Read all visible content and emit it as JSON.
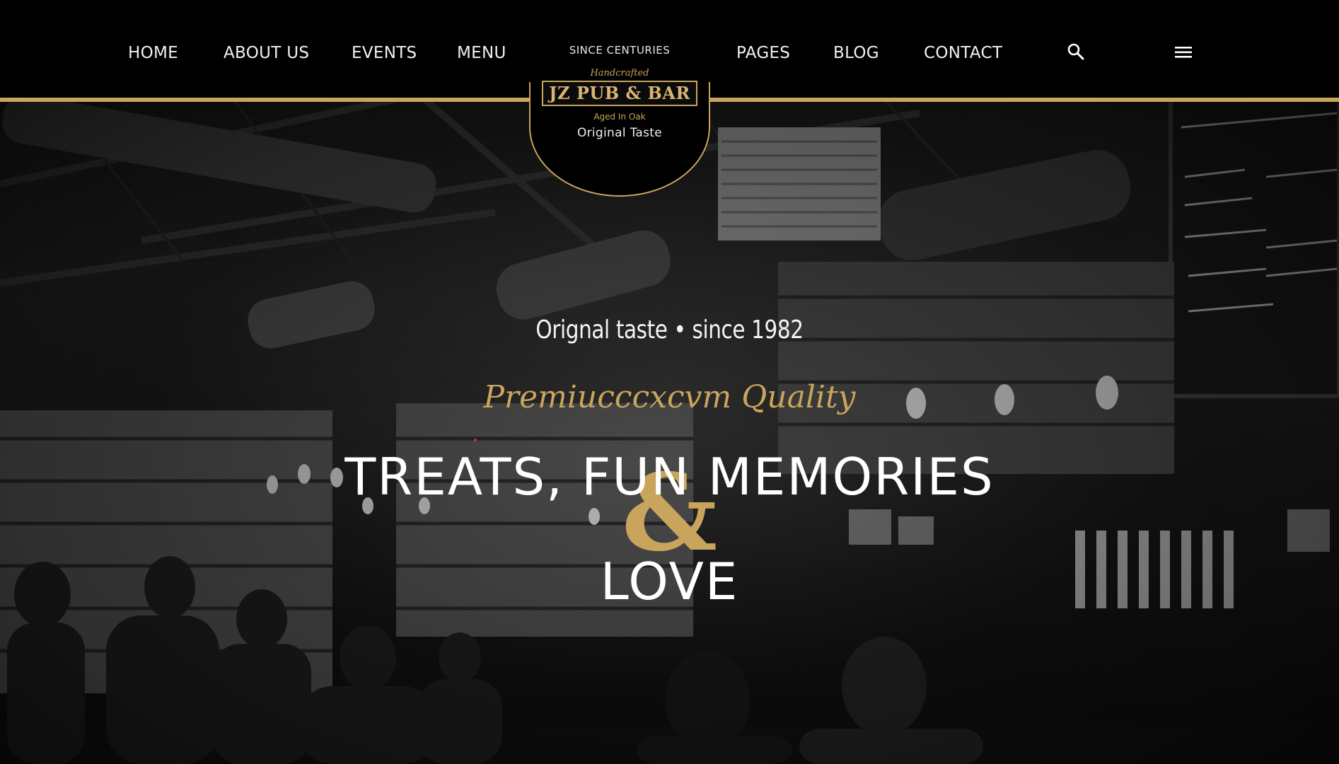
{
  "nav": {
    "left": [
      {
        "label": "HOME"
      },
      {
        "label": "ABOUT US"
      },
      {
        "label": "EVENTS"
      },
      {
        "label": "MENU"
      }
    ],
    "right": [
      {
        "label": "PAGES"
      },
      {
        "label": "BLOG"
      },
      {
        "label": "CONTACT"
      }
    ],
    "search_icon": "search-icon",
    "menu_icon": "hamburger-menu-icon"
  },
  "logo": {
    "since": "SINCE CENTURIES",
    "handcrafted": "Handcrafted",
    "title": "JZ PUB & BAR",
    "aged": "Aged In Oak",
    "original": "Original Taste"
  },
  "hero": {
    "tagline": "Orignal taste • since 1982",
    "quality": "Premiucccxcvm Quality",
    "headline": "TREATS, FUN MEMORIES",
    "ampersand": "&",
    "headline2": "LOVE"
  },
  "colors": {
    "accent_gold": "#c9a45c",
    "header_bg": "#000000",
    "text": "#ffffff"
  }
}
